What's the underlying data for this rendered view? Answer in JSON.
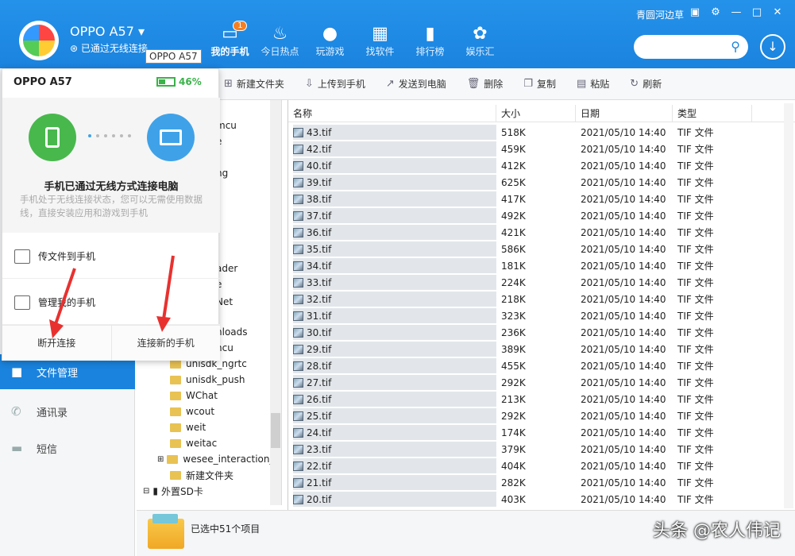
{
  "header": {
    "device_name": "OPPO A57",
    "device_status": "已通过无线连接",
    "tooltip": "OPPO A57",
    "user": "青圆河边草",
    "nav": [
      {
        "label": "我的手机",
        "icon": "phone-icon",
        "badge": "1"
      },
      {
        "label": "今日热点",
        "icon": "fire-icon"
      },
      {
        "label": "玩游戏",
        "icon": "gamepad-icon"
      },
      {
        "label": "找软件",
        "icon": "apps-icon"
      },
      {
        "label": "排行榜",
        "icon": "chart-icon"
      },
      {
        "label": "娱乐汇",
        "icon": "film-icon"
      }
    ]
  },
  "sidebar": {
    "items": [
      {
        "label": "文件管理",
        "icon": "folder-icon"
      },
      {
        "label": "通讯录",
        "icon": "phone-icon"
      },
      {
        "label": "短信",
        "icon": "message-icon"
      }
    ]
  },
  "toolbar": {
    "buttons": [
      "新建文件夹",
      "上传到手机",
      "发送到电脑",
      "删除",
      "复制",
      "粘贴",
      "刷新"
    ]
  },
  "tree": {
    "partial": [
      "mcu",
      "e",
      "ng",
      "ader",
      "e",
      "Net",
      "nloads",
      "ncu"
    ],
    "folders": [
      "unisdk_ngrtc",
      "unisdk_push",
      "WChat",
      "wcout",
      "weit",
      "weitac",
      "wesee_interaction_",
      "新建文件夹"
    ],
    "sdcard": "外置SD卡"
  },
  "list": {
    "columns": [
      "名称",
      "大小",
      "日期",
      "类型"
    ],
    "rows": [
      [
        "43.tif",
        "518K",
        "2021/05/10 14:40",
        "TIF 文件"
      ],
      [
        "42.tif",
        "459K",
        "2021/05/10 14:40",
        "TIF 文件"
      ],
      [
        "40.tif",
        "412K",
        "2021/05/10 14:40",
        "TIF 文件"
      ],
      [
        "39.tif",
        "625K",
        "2021/05/10 14:40",
        "TIF 文件"
      ],
      [
        "38.tif",
        "417K",
        "2021/05/10 14:40",
        "TIF 文件"
      ],
      [
        "37.tif",
        "492K",
        "2021/05/10 14:40",
        "TIF 文件"
      ],
      [
        "36.tif",
        "421K",
        "2021/05/10 14:40",
        "TIF 文件"
      ],
      [
        "35.tif",
        "586K",
        "2021/05/10 14:40",
        "TIF 文件"
      ],
      [
        "34.tif",
        "181K",
        "2021/05/10 14:40",
        "TIF 文件"
      ],
      [
        "33.tif",
        "224K",
        "2021/05/10 14:40",
        "TIF 文件"
      ],
      [
        "32.tif",
        "218K",
        "2021/05/10 14:40",
        "TIF 文件"
      ],
      [
        "31.tif",
        "323K",
        "2021/05/10 14:40",
        "TIF 文件"
      ],
      [
        "30.tif",
        "236K",
        "2021/05/10 14:40",
        "TIF 文件"
      ],
      [
        "29.tif",
        "389K",
        "2021/05/10 14:40",
        "TIF 文件"
      ],
      [
        "28.tif",
        "455K",
        "2021/05/10 14:40",
        "TIF 文件"
      ],
      [
        "27.tif",
        "292K",
        "2021/05/10 14:40",
        "TIF 文件"
      ],
      [
        "26.tif",
        "213K",
        "2021/05/10 14:40",
        "TIF 文件"
      ],
      [
        "25.tif",
        "292K",
        "2021/05/10 14:40",
        "TIF 文件"
      ],
      [
        "24.tif",
        "174K",
        "2021/05/10 14:40",
        "TIF 文件"
      ],
      [
        "23.tif",
        "379K",
        "2021/05/10 14:40",
        "TIF 文件"
      ],
      [
        "22.tif",
        "404K",
        "2021/05/10 14:40",
        "TIF 文件"
      ],
      [
        "21.tif",
        "282K",
        "2021/05/10 14:40",
        "TIF 文件"
      ],
      [
        "20.tif",
        "403K",
        "2021/05/10 14:40",
        "TIF 文件"
      ]
    ]
  },
  "status": {
    "text": "已选中51个项目"
  },
  "popup": {
    "title": "OPPO A57",
    "battery": "46%",
    "battery_level": 0.46,
    "message": "手机已通过无线方式连接电脑",
    "description": "手机处于无线连接状态，您可以无需使用数据线，直接安装应用和游戏到手机",
    "options": [
      "传文件到手机",
      "管理我的手机"
    ],
    "disconnect": "断开连接",
    "connect_new": "连接新的手机"
  },
  "watermark": "头条 @农人伟记",
  "colors": {
    "primary": "#1a83de",
    "battery": "#3bb24a",
    "arrow": "#e8312f"
  }
}
